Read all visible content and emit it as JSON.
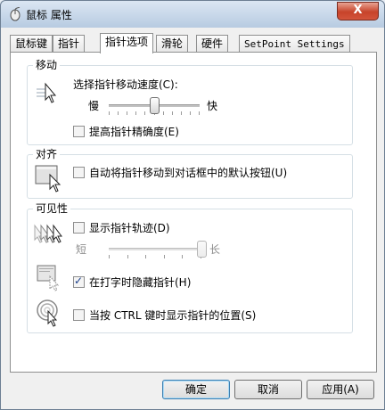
{
  "window": {
    "title": "鼠标 属性",
    "close_label": "X"
  },
  "tabs": [
    {
      "label": "鼠标键"
    },
    {
      "label": "指针"
    },
    {
      "label": "指针选项"
    },
    {
      "label": "滑轮"
    },
    {
      "label": "硬件"
    },
    {
      "label": "SetPoint Settings"
    }
  ],
  "active_tab": "指针选项",
  "motion": {
    "title": "移动",
    "speed_label": "选择指针移动速度(C):",
    "slow": "慢",
    "fast": "快",
    "speed_value": 0.5,
    "precision_label": "提高指针精确度(E)",
    "precision_checked": false
  },
  "snap": {
    "title": "对齐",
    "snap_label": "自动将指针移动到对话框中的默认按钮(U)",
    "snap_checked": false
  },
  "visibility": {
    "title": "可见性",
    "trails_label": "显示指针轨迹(D)",
    "trails_checked": false,
    "short": "短",
    "long": "长",
    "trails_value": 1.0,
    "hide_label": "在打字时隐藏指针(H)",
    "hide_checked": true,
    "ctrl_label": "当按 CTRL 键时显示指针的位置(S)",
    "ctrl_checked": false
  },
  "buttons": {
    "ok": "确定",
    "cancel": "取消",
    "apply": "应用(A)"
  },
  "colors": {
    "accent": "#3c7fb1",
    "close": "#c7432a"
  }
}
